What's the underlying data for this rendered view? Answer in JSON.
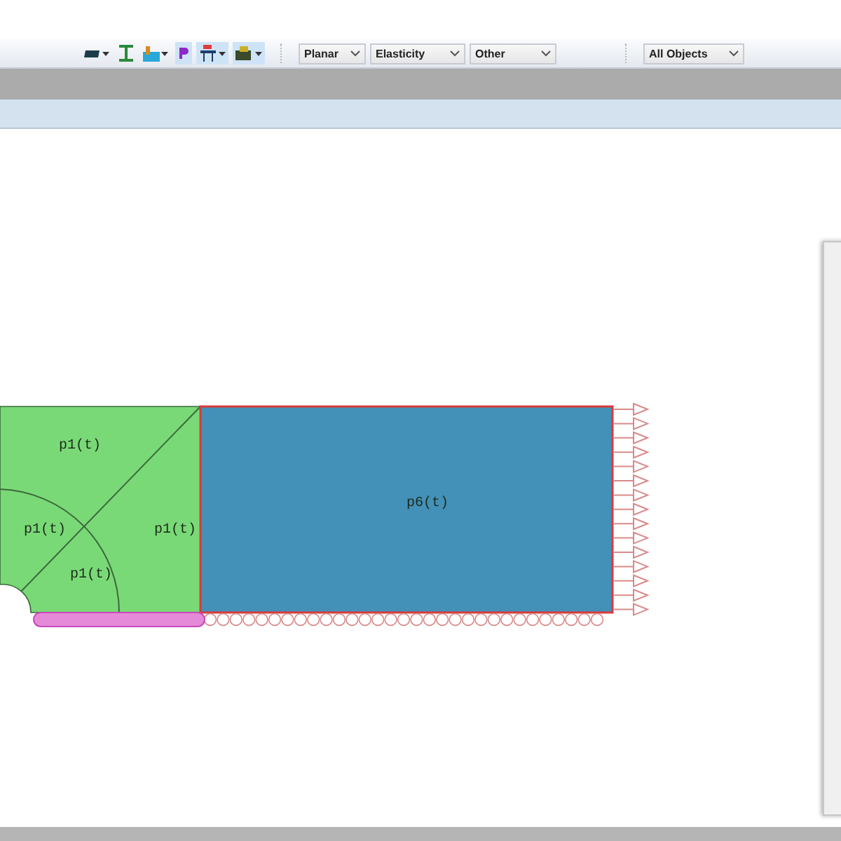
{
  "toolbar": {
    "dropdowns": [
      {
        "value": "Planar"
      },
      {
        "value": "Elasticity"
      },
      {
        "value": "Other"
      },
      {
        "value": "All Objects"
      }
    ]
  },
  "canvas": {
    "subdomains": [
      {
        "label": "p1(t)"
      },
      {
        "label": "p1(t)"
      },
      {
        "label": "p1(t)"
      },
      {
        "label": "p1(t)"
      },
      {
        "label": "p6(t)"
      }
    ]
  }
}
